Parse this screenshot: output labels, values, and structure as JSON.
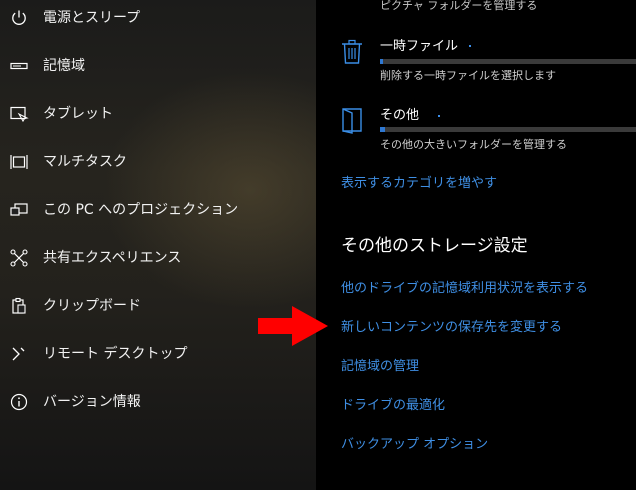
{
  "sidebar": {
    "items": [
      {
        "label": "電源とスリープ",
        "icon": "power-icon"
      },
      {
        "label": "記憶域",
        "icon": "storage-icon"
      },
      {
        "label": "タブレット",
        "icon": "tablet-icon"
      },
      {
        "label": "マルチタスク",
        "icon": "multitask-icon"
      },
      {
        "label": "この PC へのプロジェクション",
        "icon": "projection-icon"
      },
      {
        "label": "共有エクスペリエンス",
        "icon": "shared-experience-icon"
      },
      {
        "label": "クリップボード",
        "icon": "clipboard-icon"
      },
      {
        "label": "リモート デスクトップ",
        "icon": "remote-desktop-icon"
      },
      {
        "label": "バージョン情報",
        "icon": "info-icon"
      }
    ]
  },
  "content": {
    "truncated_top_text": "ピクチャ フォルダーを管理する",
    "categories": [
      {
        "title": "一時ファイル",
        "description": "削除する一時ファイルを選択します",
        "icon": "trash-icon",
        "usage_fraction": 0.01
      },
      {
        "title": "その他",
        "description": "その他の大きいフォルダーを管理する",
        "icon": "folder-other-icon",
        "usage_fraction": 0.02
      }
    ],
    "show_more_link": "表示するカテゴリを増やす",
    "other_settings_heading": "その他のストレージ設定",
    "links": [
      "他のドライブの記憶域利用状況を表示する",
      "新しいコンテンツの保存先を変更する",
      "記憶域の管理",
      "ドライブの最適化",
      "バックアップ オプション"
    ]
  },
  "colors": {
    "link": "#3f8fe4",
    "bar_fill": "#2f78d2",
    "bar_track": "#3a3a3a",
    "arrow": "#ff0000",
    "content_bg": "#000000"
  }
}
